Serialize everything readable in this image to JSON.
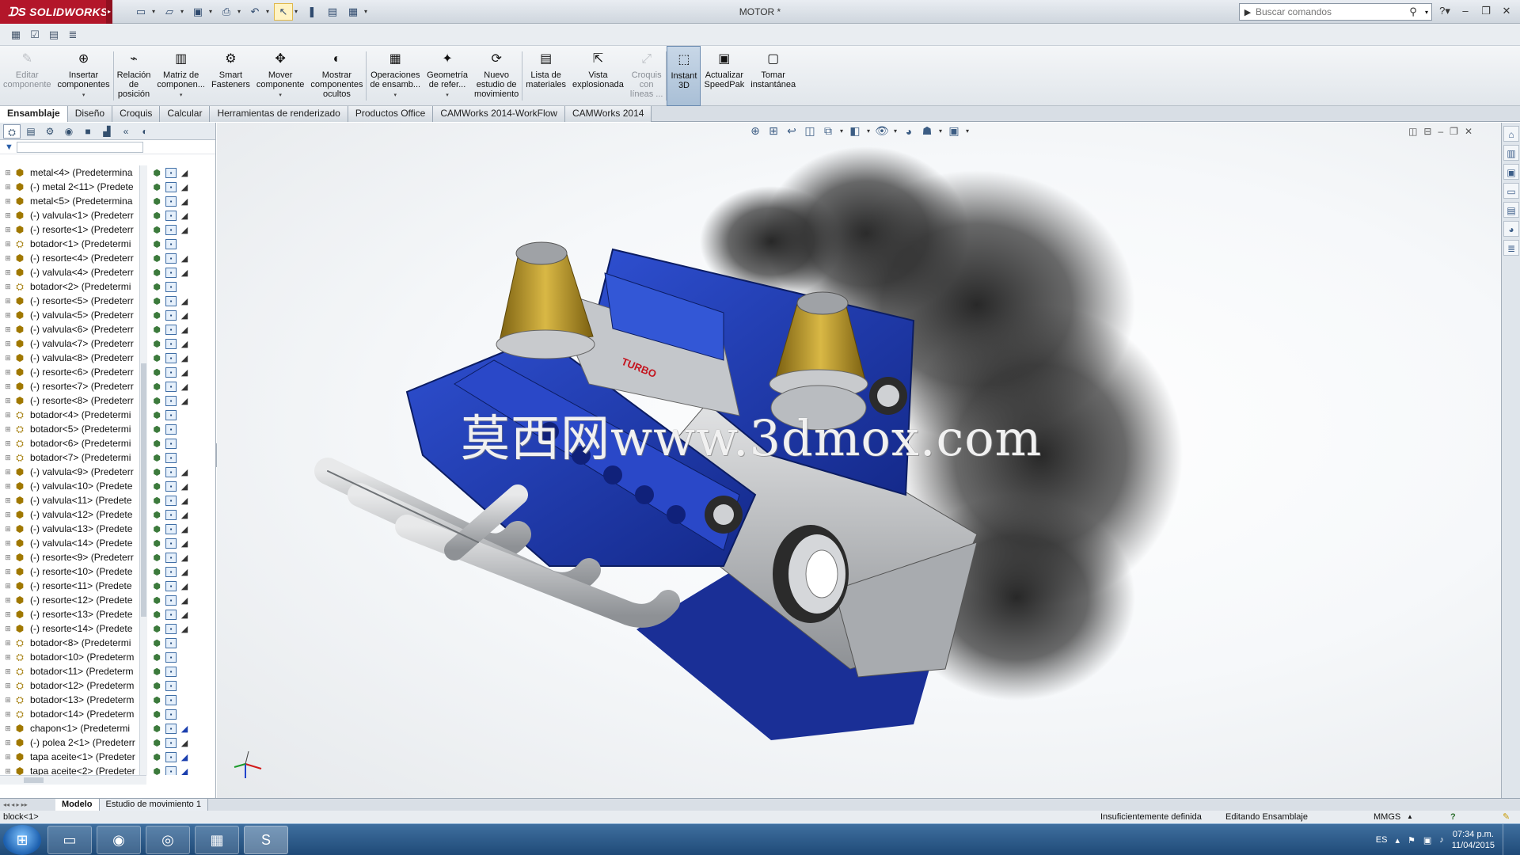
{
  "app": {
    "brand": "SOLIDWORKS",
    "doc_title": "MOTOR *"
  },
  "search": {
    "placeholder": "Buscar comandos"
  },
  "quick_access": [
    "new-icon",
    "open-icon",
    "save-icon",
    "print-icon",
    "undo-icon",
    "select-icon",
    "rebuild-icon",
    "file-props-icon",
    "options-icon"
  ],
  "commands": [
    {
      "label": "Editar\ncomponente",
      "icon": "edit-component-icon",
      "disabled": true
    },
    {
      "label": "Insertar\ncomponentes",
      "icon": "insert-components-icon",
      "dropdown": true
    },
    {
      "label": "Relación\nde\nposición",
      "icon": "mate-icon"
    },
    {
      "label": "Matriz de\ncomponen...",
      "icon": "pattern-icon",
      "dropdown": true
    },
    {
      "label": "Smart\nFasteners",
      "icon": "fasteners-icon"
    },
    {
      "label": "Mover\ncomponente",
      "icon": "move-component-icon",
      "dropdown": true
    },
    {
      "label": "Mostrar\ncomponentes\nocultos",
      "icon": "show-hidden-icon"
    },
    {
      "label": "Operaciones\nde ensamb...",
      "icon": "assembly-features-icon",
      "dropdown": true
    },
    {
      "label": "Geometría\nde refer...",
      "icon": "reference-geometry-icon",
      "dropdown": true
    },
    {
      "label": "Nuevo\nestudio de\nmovimiento",
      "icon": "motion-study-icon"
    },
    {
      "label": "Lista de\nmateriales",
      "icon": "bom-icon"
    },
    {
      "label": "Vista\nexplosionada",
      "icon": "exploded-view-icon"
    },
    {
      "label": "Croquis\ncon\nlíneas ...",
      "icon": "explode-line-sketch-icon",
      "disabled": true
    },
    {
      "label": "Instant\n3D",
      "icon": "instant3d-icon",
      "active": true
    },
    {
      "label": "Actualizar\nSpeedPak",
      "icon": "speedpak-icon"
    },
    {
      "label": "Tomar\ninstantánea",
      "icon": "snapshot-icon"
    }
  ],
  "tabs": [
    "Ensamblaje",
    "Diseño",
    "Croquis",
    "Calcular",
    "Herramientas de renderizado",
    "Productos Office",
    "CAMWorks 2014-WorkFlow",
    "CAMWorks 2014"
  ],
  "active_tab": 0,
  "tree": [
    {
      "label": "metal<4> (Predetermina",
      "type": "part",
      "mate_end": "dim"
    },
    {
      "label": "(-) metal 2<11> (Predete",
      "type": "part",
      "mate_end": "dim"
    },
    {
      "label": "metal<5> (Predetermina",
      "type": "part",
      "mate_end": "dim"
    },
    {
      "label": "(-) valvula<1> (Predeterr",
      "type": "part",
      "mate_end": "dim"
    },
    {
      "label": "(-) resorte<1> (Predeterr",
      "type": "part",
      "mate_end": "dim"
    },
    {
      "label": "botador<1> (Predetermi",
      "type": "assembly",
      "mate_end": ""
    },
    {
      "label": "(-) resorte<4> (Predeterr",
      "type": "part",
      "mate_end": "dim"
    },
    {
      "label": "(-) valvula<4> (Predeterr",
      "type": "part",
      "mate_end": "dim"
    },
    {
      "label": "botador<2> (Predetermi",
      "type": "assembly",
      "mate_end": ""
    },
    {
      "label": "(-) resorte<5> (Predeterr",
      "type": "part",
      "mate_end": "dim"
    },
    {
      "label": "(-) valvula<5> (Predeterr",
      "type": "part",
      "mate_end": "dim"
    },
    {
      "label": "(-) valvula<6> (Predeterr",
      "type": "part",
      "mate_end": "dim"
    },
    {
      "label": "(-) valvula<7> (Predeterr",
      "type": "part",
      "mate_end": "dim"
    },
    {
      "label": "(-) valvula<8> (Predeterr",
      "type": "part",
      "mate_end": "dim"
    },
    {
      "label": "(-) resorte<6> (Predeterr",
      "type": "part",
      "mate_end": "dim"
    },
    {
      "label": "(-) resorte<7> (Predeterr",
      "type": "part",
      "mate_end": "dim"
    },
    {
      "label": "(-) resorte<8> (Predeterr",
      "type": "part",
      "mate_end": "dim"
    },
    {
      "label": "botador<4> (Predetermi",
      "type": "assembly",
      "mate_end": ""
    },
    {
      "label": "botador<5> (Predetermi",
      "type": "assembly",
      "mate_end": ""
    },
    {
      "label": "botador<6> (Predetermi",
      "type": "assembly",
      "mate_end": ""
    },
    {
      "label": "botador<7> (Predetermi",
      "type": "assembly",
      "mate_end": ""
    },
    {
      "label": "(-) valvula<9> (Predeterr",
      "type": "part",
      "mate_end": "dim"
    },
    {
      "label": "(-) valvula<10> (Predete",
      "type": "part",
      "mate_end": "dim"
    },
    {
      "label": "(-) valvula<11> (Predete",
      "type": "part",
      "mate_end": "dim"
    },
    {
      "label": "(-) valvula<12> (Predete",
      "type": "part",
      "mate_end": "dim"
    },
    {
      "label": "(-) valvula<13> (Predete",
      "type": "part",
      "mate_end": "dim"
    },
    {
      "label": "(-) valvula<14> (Predete",
      "type": "part",
      "mate_end": "dim"
    },
    {
      "label": "(-) resorte<9> (Predeterr",
      "type": "part",
      "mate_end": "dim"
    },
    {
      "label": "(-) resorte<10> (Predete",
      "type": "part",
      "mate_end": "dim"
    },
    {
      "label": "(-) resorte<11> (Predete",
      "type": "part",
      "mate_end": "dim"
    },
    {
      "label": "(-) resorte<12> (Predete",
      "type": "part",
      "mate_end": "dim"
    },
    {
      "label": "(-) resorte<13> (Predete",
      "type": "part",
      "mate_end": "dim"
    },
    {
      "label": "(-) resorte<14> (Predete",
      "type": "part",
      "mate_end": "dim"
    },
    {
      "label": "botador<8> (Predetermi",
      "type": "assembly",
      "mate_end": ""
    },
    {
      "label": "botador<10> (Predeterm",
      "type": "assembly",
      "mate_end": ""
    },
    {
      "label": "botador<11> (Predeterm",
      "type": "assembly",
      "mate_end": ""
    },
    {
      "label": "botador<12> (Predeterm",
      "type": "assembly",
      "mate_end": ""
    },
    {
      "label": "botador<13> (Predeterm",
      "type": "assembly",
      "mate_end": ""
    },
    {
      "label": "botador<14> (Predeterm",
      "type": "assembly",
      "mate_end": ""
    },
    {
      "label": "chapon<1> (Predetermi",
      "type": "part",
      "mate_end": "blue"
    },
    {
      "label": "(-) polea 2<1> (Predeterr",
      "type": "part",
      "mate_end": "dim"
    },
    {
      "label": "tapa aceite<1> (Predeter",
      "type": "part",
      "mate_end": "blue"
    },
    {
      "label": "tapa aceite<2> (Predeter",
      "type": "part",
      "mate_end": "blue"
    }
  ],
  "viewport": {
    "watermark": "莫西网www.3dmox.com",
    "colors": {
      "block_blue": "#1d3aa8",
      "filter_gold": "#b8952a",
      "steel": "#b9bcc0"
    }
  },
  "bottom_tabs": [
    "Modelo",
    "Estudio de movimiento 1"
  ],
  "status": {
    "selection": "block<1>",
    "definition": "Insuficientemente definida",
    "mode": "Editando Ensamblaje",
    "units": "MMGS"
  },
  "taskbar": {
    "apps": [
      "explorer-icon",
      "chrome-icon",
      "media-icon",
      "calculator-icon",
      "solidworks-icon"
    ],
    "lang": "ES",
    "time": "07:34 p.m.",
    "date": "11/04/2015"
  }
}
